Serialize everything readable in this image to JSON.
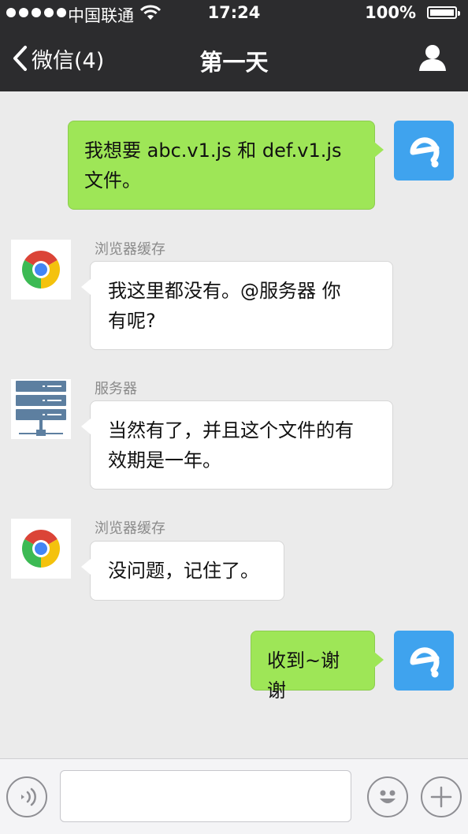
{
  "status_bar": {
    "carrier": "中国联通",
    "time": "17:24",
    "battery": "100%",
    "icons": [
      "signal-dots-icon",
      "wifi-icon",
      "battery-icon"
    ]
  },
  "nav": {
    "back_label": "微信(4)",
    "title": "第一天",
    "icons": [
      "back-chevron-icon",
      "profile-icon"
    ]
  },
  "messages": [
    {
      "side": "right",
      "avatar": "e-logo-icon",
      "lines": [
        "我想要 abc.v1.js 和 def.v1.js",
        "文件。"
      ]
    },
    {
      "side": "left",
      "sender": "浏览器缓存",
      "avatar": "chrome-icon",
      "lines": [
        "我这里都没有。@服务器 你",
        "有呢?"
      ]
    },
    {
      "side": "left",
      "sender": "服务器",
      "avatar": "server-icon",
      "lines": [
        "当然有了，并且这个文件的有",
        "效期是一年。"
      ]
    },
    {
      "side": "left",
      "sender": "浏览器缓存",
      "avatar": "chrome-icon",
      "lines": [
        "没问题，记住了。"
      ]
    },
    {
      "side": "right",
      "avatar": "e-logo-icon",
      "lines": [
        "收到~谢谢"
      ]
    }
  ],
  "toolbar": {
    "input_value": "",
    "icons": [
      "voice-icon",
      "emoji-icon",
      "plus-icon"
    ]
  },
  "colors": {
    "bar_bg": "#2c2c2e",
    "chat_bg": "#ebebeb",
    "outgoing_bubble": "#9ee657",
    "incoming_bubble": "#ffffff",
    "brand_blue": "#3fa3ee"
  }
}
